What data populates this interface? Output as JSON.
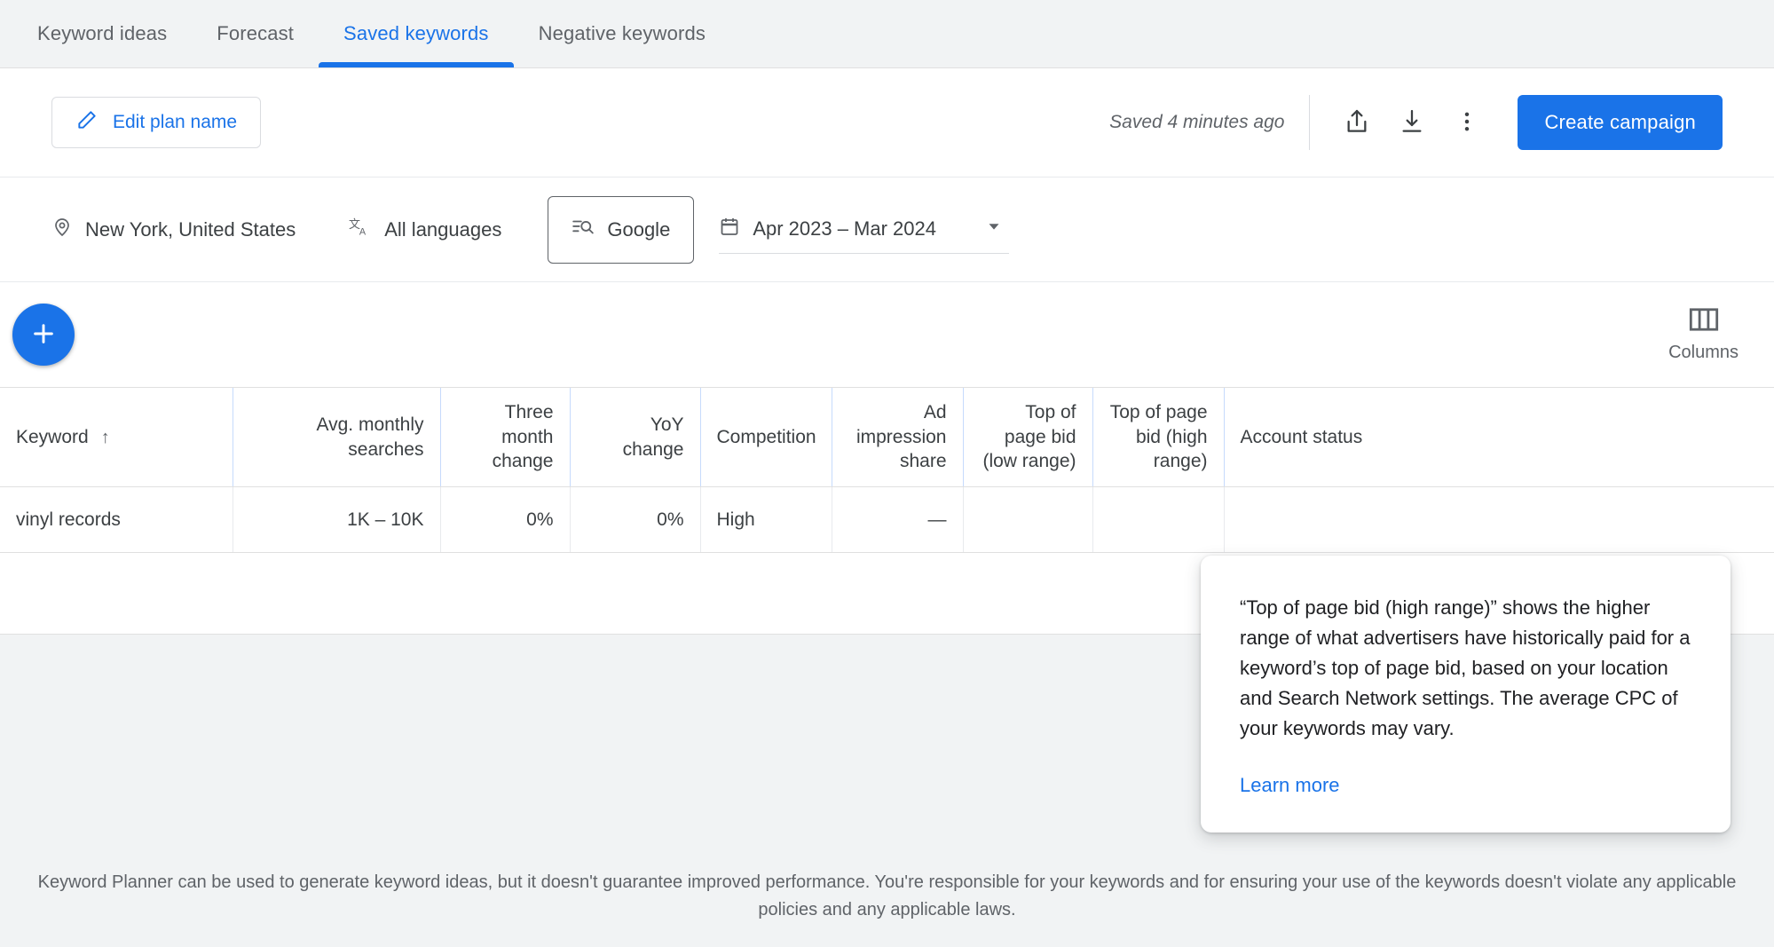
{
  "tabs": [
    {
      "label": "Keyword ideas",
      "active": false
    },
    {
      "label": "Forecast",
      "active": false
    },
    {
      "label": "Saved keywords",
      "active": true
    },
    {
      "label": "Negative keywords",
      "active": false
    }
  ],
  "toolbar": {
    "edit_plan_label": "Edit plan name",
    "saved_status": "Saved 4 minutes ago",
    "share_icon": "share-icon",
    "download_icon": "download-icon",
    "more_icon": "more-vert-icon",
    "create_campaign_label": "Create campaign"
  },
  "filters": {
    "location": "New York, United States",
    "language": "All languages",
    "network": "Google",
    "date_range": "Apr 2023 – Mar 2024"
  },
  "actions": {
    "add_label": "+",
    "columns_label": "Columns"
  },
  "table": {
    "columns": [
      {
        "label": "Keyword",
        "align": "left",
        "sorted": true,
        "sort_arrow": "↑"
      },
      {
        "label": "Avg. monthly searches",
        "align": "right"
      },
      {
        "label": "Three month change",
        "align": "right"
      },
      {
        "label": "YoY change",
        "align": "right"
      },
      {
        "label": "Competition",
        "align": "left"
      },
      {
        "label": "Ad impression share",
        "align": "right"
      },
      {
        "label": "Top of page bid (low range)",
        "align": "right"
      },
      {
        "label": "Top of page bid (high range)",
        "align": "right"
      },
      {
        "label": "Account status",
        "align": "left"
      }
    ],
    "rows": [
      {
        "keyword": "vinyl records",
        "avg_monthly_searches": "1K – 10K",
        "three_month_change": "0%",
        "yoy_change": "0%",
        "competition": "High",
        "ad_impression_share": "—",
        "top_of_page_bid_low": "",
        "top_of_page_bid_high": "",
        "account_status": ""
      }
    ]
  },
  "tooltip": {
    "body": "“Top of page bid (high range)” shows the higher range of what advertisers have historically paid for a keyword’s top of page bid, based on your location and Search Network settings. The average CPC of your keywords may vary.",
    "link_label": "Learn more"
  },
  "footer": {
    "text": "Keyword Planner can be used to generate keyword ideas, but it doesn't guarantee improved performance. You're responsible for your keywords and for ensuring your use of the keywords doesn't violate any applicable policies and any applicable laws."
  },
  "colors": {
    "accent": "#1a73e8",
    "page_bg": "#f1f3f4",
    "card_bg": "#ffffff",
    "text_primary": "#3c4043",
    "text_secondary": "#5f6368",
    "border": "#e0e0e0",
    "header_border": "#c6dafc"
  }
}
